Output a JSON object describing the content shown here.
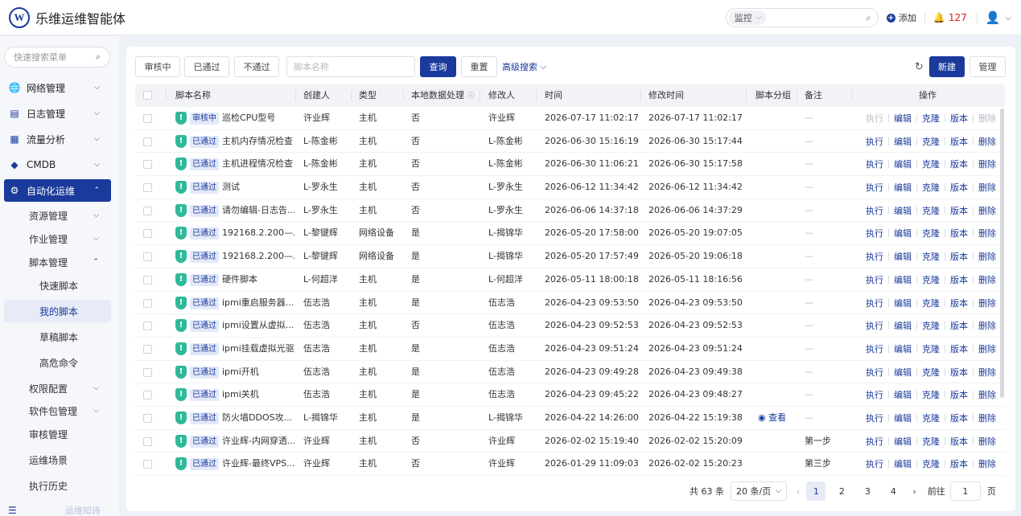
{
  "header": {
    "app_title": "乐维运维智能体",
    "logo_letter": "W",
    "search_category": "监控",
    "add_label": "添加",
    "alert_count": "127"
  },
  "sidebar": {
    "search_placeholder": "快速搜索菜单",
    "items": [
      {
        "label": "网络管理",
        "icon": "globe-icon"
      },
      {
        "label": "日志管理",
        "icon": "log-icon"
      },
      {
        "label": "流量分析",
        "icon": "chart-icon"
      },
      {
        "label": "CMDB",
        "icon": "cube-icon"
      },
      {
        "label": "自动化运维",
        "icon": "gear-icon"
      }
    ],
    "sub_items": [
      "资源管理",
      "作业管理",
      "脚本管理"
    ],
    "script_children": [
      "快速脚本",
      "我的脚本",
      "草稿脚本",
      "高危命令"
    ],
    "sub_items_after": [
      "权限配置",
      "软件包管理",
      "审核管理",
      "运维场景",
      "执行历史"
    ],
    "faint_label": "运维知诗"
  },
  "toolbar": {
    "tab_pending": "审核中",
    "tab_passed": "已通过",
    "tab_rejected": "不通过",
    "name_placeholder": "脚本名称",
    "query": "查询",
    "reset": "重置",
    "advanced": "高级搜索",
    "new": "新建",
    "manage": "管理"
  },
  "table": {
    "headers": {
      "name": "脚本名称",
      "creator": "创建人",
      "type": "类型",
      "local": "本地数据处理",
      "modifier": "修改人",
      "time": "时间",
      "mtime": "修改时间",
      "group": "脚本分组",
      "note": "备注",
      "ops": "操作"
    },
    "ops": [
      "执行",
      "编辑",
      "克隆",
      "版本",
      "删除"
    ],
    "view_label": "查看",
    "rows": [
      {
        "status": "审核中",
        "name": "巡检CPU型号",
        "creator": "许业辉",
        "type": "主机",
        "local": "否",
        "modifier": "许业辉",
        "time": "2026-07-17 11:02:17",
        "mtime": "2026-07-17 11:02:17",
        "group": "",
        "note": "—",
        "disabled": true
      },
      {
        "status": "已通过",
        "name": "主机内存情况检查",
        "creator": "L-陈金彬",
        "type": "主机",
        "local": "否",
        "modifier": "L-陈金彬",
        "time": "2026-06-30 15:16:19",
        "mtime": "2026-06-30 15:17:44",
        "group": "",
        "note": "—",
        "disabled": false
      },
      {
        "status": "已通过",
        "name": "主机进程情况检查",
        "creator": "L-陈金彬",
        "type": "主机",
        "local": "否",
        "modifier": "L-陈金彬",
        "time": "2026-06-30 11:06:21",
        "mtime": "2026-06-30 15:17:58",
        "group": "",
        "note": "—",
        "disabled": false
      },
      {
        "status": "已通过",
        "name": "测试",
        "creator": "L-罗永生",
        "type": "主机",
        "local": "否",
        "modifier": "L-罗永生",
        "time": "2026-06-12 11:34:42",
        "mtime": "2026-06-12 11:34:42",
        "group": "",
        "note": "—",
        "disabled": false
      },
      {
        "status": "已通过",
        "name": "请勿编辑-日志告...",
        "creator": "L-罗永生",
        "type": "主机",
        "local": "否",
        "modifier": "L-罗永生",
        "time": "2026-06-06 14:37:18",
        "mtime": "2026-06-06 14:37:29",
        "group": "",
        "note": "—",
        "disabled": false
      },
      {
        "status": "已通过",
        "name": "192168.2.200—...",
        "creator": "L-黎键辉",
        "type": "网络设备",
        "local": "是",
        "modifier": "L-揭锦华",
        "time": "2026-05-20 17:58:00",
        "mtime": "2026-05-20 19:07:05",
        "group": "",
        "note": "—",
        "disabled": false
      },
      {
        "status": "已通过",
        "name": "192168.2.200—...",
        "creator": "L-黎键辉",
        "type": "网络设备",
        "local": "是",
        "modifier": "L-揭锦华",
        "time": "2026-05-20 17:57:49",
        "mtime": "2026-05-20 19:06:18",
        "group": "",
        "note": "—",
        "disabled": false
      },
      {
        "status": "已通过",
        "name": "硬件脚本",
        "creator": "L-何超洋",
        "type": "主机",
        "local": "是",
        "modifier": "L-何超洋",
        "time": "2026-05-11 18:00:18",
        "mtime": "2026-05-11 18:16:56",
        "group": "",
        "note": "—",
        "disabled": false
      },
      {
        "status": "已通过",
        "name": "ipmi重启服务器...",
        "creator": "伍志浩",
        "type": "主机",
        "local": "是",
        "modifier": "伍志浩",
        "time": "2026-04-23 09:53:50",
        "mtime": "2026-04-23 09:53:50",
        "group": "",
        "note": "—",
        "disabled": false
      },
      {
        "status": "已通过",
        "name": "ipmi设置从虚拟...",
        "creator": "伍志浩",
        "type": "主机",
        "local": "否",
        "modifier": "伍志浩",
        "time": "2026-04-23 09:52:53",
        "mtime": "2026-04-23 09:52:53",
        "group": "",
        "note": "—",
        "disabled": false
      },
      {
        "status": "已通过",
        "name": "ipmi挂载虚拟光驱",
        "creator": "伍志浩",
        "type": "主机",
        "local": "是",
        "modifier": "伍志浩",
        "time": "2026-04-23 09:51:24",
        "mtime": "2026-04-23 09:51:24",
        "group": "",
        "note": "—",
        "disabled": false
      },
      {
        "status": "已通过",
        "name": "ipmi开机",
        "creator": "伍志浩",
        "type": "主机",
        "local": "是",
        "modifier": "伍志浩",
        "time": "2026-04-23 09:49:28",
        "mtime": "2026-04-23 09:49:38",
        "group": "",
        "note": "—",
        "disabled": false
      },
      {
        "status": "已通过",
        "name": "ipmi关机",
        "creator": "伍志浩",
        "type": "主机",
        "local": "是",
        "modifier": "伍志浩",
        "time": "2026-04-23 09:45:22",
        "mtime": "2026-04-23 09:48:27",
        "group": "",
        "note": "—",
        "disabled": false
      },
      {
        "status": "已通过",
        "name": "防火墙DDOS攻...",
        "creator": "L-揭锦华",
        "type": "主机",
        "local": "是",
        "modifier": "L-揭锦华",
        "time": "2026-04-22 14:26:00",
        "mtime": "2026-04-22 15:19:38",
        "group": "查看",
        "note": "—",
        "disabled": false
      },
      {
        "status": "已通过",
        "name": "许业辉-内网穿透...",
        "creator": "许业辉",
        "type": "主机",
        "local": "否",
        "modifier": "许业辉",
        "time": "2026-02-02 15:19:40",
        "mtime": "2026-02-02 15:20:09",
        "group": "",
        "note": "第一步",
        "disabled": false
      },
      {
        "status": "已通过",
        "name": "许业辉-最终VPS...",
        "creator": "许业辉",
        "type": "主机",
        "local": "否",
        "modifier": "许业辉",
        "time": "2026-01-29 11:09:03",
        "mtime": "2026-02-02 15:20:23",
        "group": "",
        "note": "第三步",
        "disabled": false
      }
    ]
  },
  "pagination": {
    "total": "共 63 条",
    "page_size": "20 条/页",
    "pages": [
      "1",
      "2",
      "3",
      "4"
    ],
    "current": "1",
    "goto_label": "前往",
    "goto_value": "1",
    "unit": "页"
  }
}
